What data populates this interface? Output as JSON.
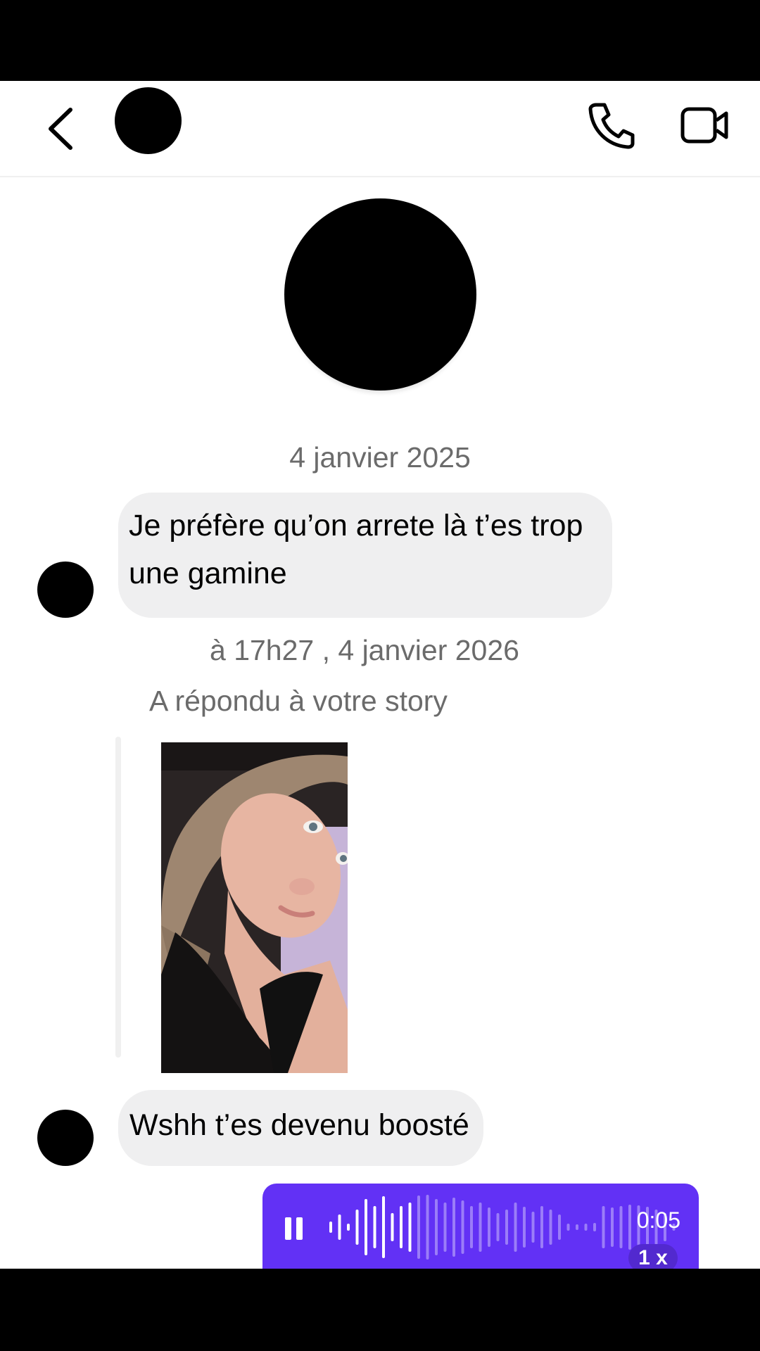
{
  "header": {
    "back_icon": "chevron-left-icon",
    "call_icon": "phone-icon",
    "video_icon": "video-camera-icon"
  },
  "messages": {
    "date_1": "4 janvier 2025",
    "msg_1": "Je préfère qu’on arrete là t’es trop une gamine",
    "date_2": "à 17h27 , 4 janvier 2026",
    "story_reply_label": "A répondu à votre story",
    "msg_2": "Wshh t’es devenu boosté"
  },
  "voice_message": {
    "duration": "0:05",
    "speed": "1 x",
    "played_fraction": 0.25,
    "accent_color": "#6231f5"
  }
}
